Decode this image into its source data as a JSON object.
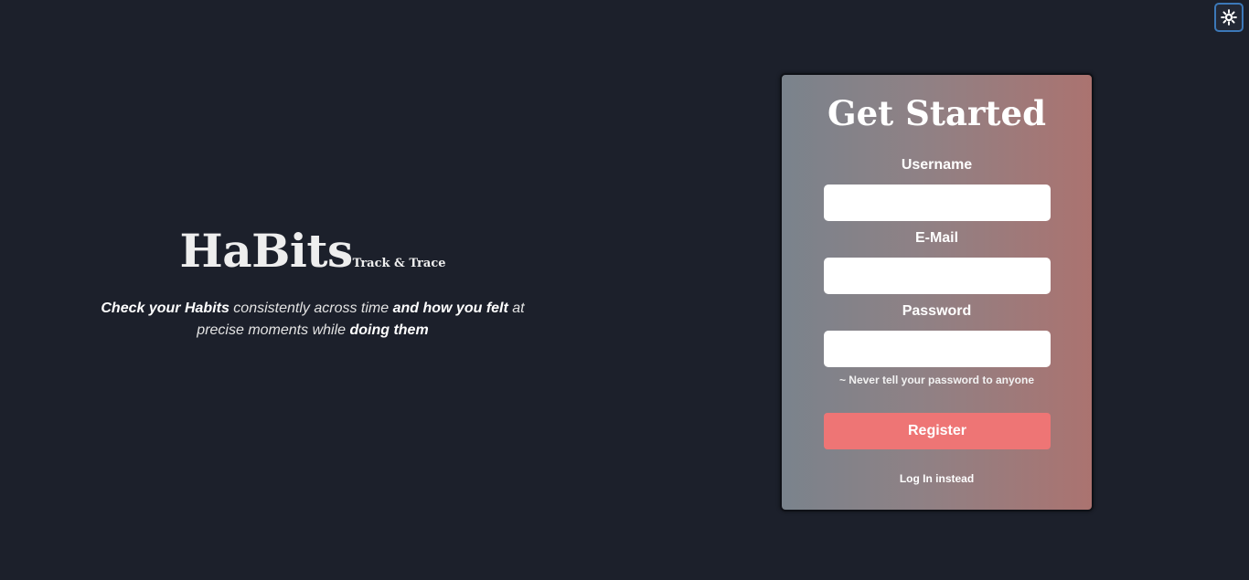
{
  "theme_toggle": {
    "icon": "sun-icon"
  },
  "hero": {
    "title": "HaBits",
    "tagline": "Track & Trace",
    "description": {
      "part1": "Check your Habits",
      "part2": " consistently across time ",
      "part3": "and how you felt",
      "part4": " at precise moments while ",
      "part5": "doing them"
    }
  },
  "form": {
    "title": "Get Started",
    "username_label": "Username",
    "username_value": "",
    "email_label": "E-Mail",
    "email_value": "",
    "password_label": "Password",
    "password_value": "",
    "password_hint": "~ Never tell your password to anyone",
    "register_label": "Register",
    "login_link": "Log In instead"
  },
  "colors": {
    "background": "#1c202b",
    "accent_button": "#ee7575",
    "toggle_border": "#3c78b8",
    "card_gradient_start": "#7a838c",
    "card_gradient_end": "#ab7370"
  }
}
